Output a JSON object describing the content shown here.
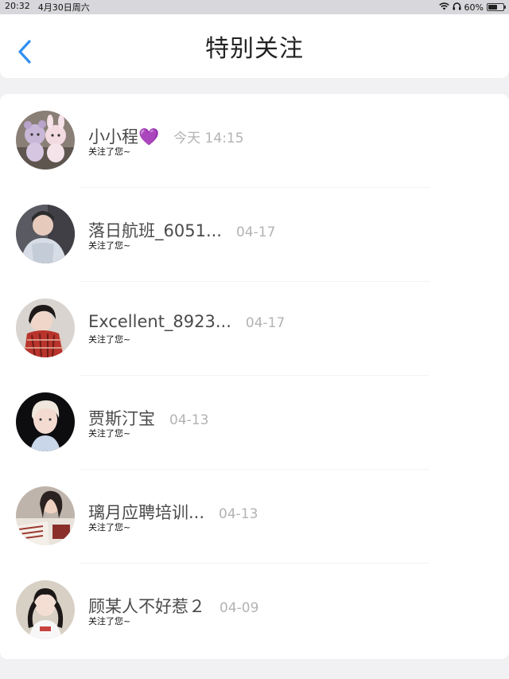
{
  "status_bar": {
    "time": "20:32",
    "date": "4月30日周六",
    "battery": "60%",
    "battery_level": 0.6
  },
  "header": {
    "title": "特别关注"
  },
  "list": [
    {
      "name": "小小程💜",
      "time": "今天 14:15",
      "sub": "关注了您~",
      "avatar": "avatar-plush-toys"
    },
    {
      "name": "落日航班_6051...",
      "time": "04-17",
      "sub": "关注了您~",
      "avatar": "avatar-person-jacket"
    },
    {
      "name": "Excellent_8923...",
      "time": "04-17",
      "sub": "关注了您~",
      "avatar": "avatar-person-scarf"
    },
    {
      "name": "贾斯汀宝",
      "time": "04-13",
      "sub": "关注了您~",
      "avatar": "avatar-person-blonde"
    },
    {
      "name": "璃月应聘培训...",
      "time": "04-13",
      "sub": "关注了您~",
      "avatar": "avatar-person-reading"
    },
    {
      "name": "顾某人不好惹２",
      "time": "04-09",
      "sub": "关注了您~",
      "avatar": "avatar-person-twintails"
    }
  ],
  "colors": {
    "accent": "#2f8ff0",
    "background": "#f1f1f3",
    "card": "#ffffff"
  }
}
